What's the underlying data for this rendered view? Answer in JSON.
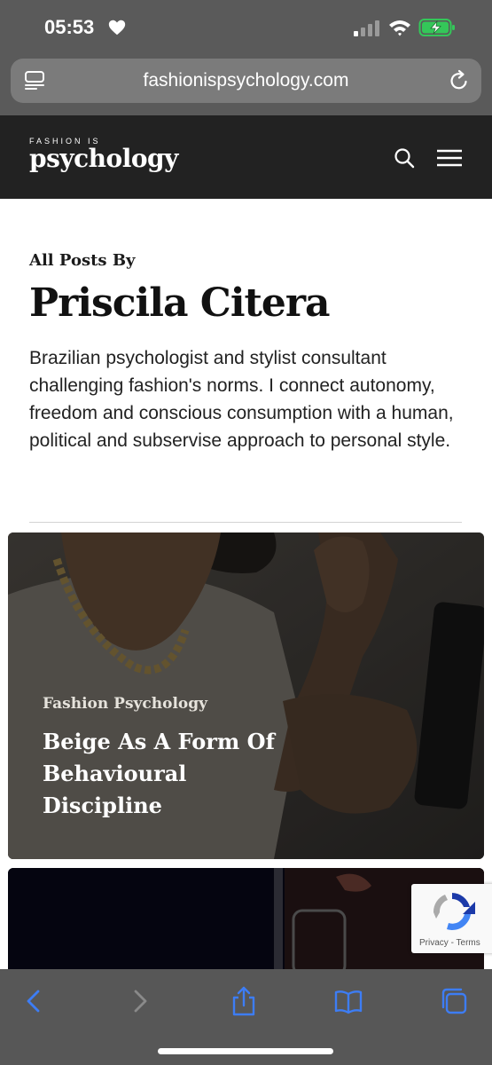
{
  "status_bar": {
    "time": "05:53"
  },
  "browser": {
    "url": "fashionispsychology.com"
  },
  "site": {
    "logo_small": "FASHION IS",
    "logo_big": "psychology"
  },
  "author": {
    "posts_by_label": "All Posts By",
    "name": "Priscila Citera",
    "bio": "Brazilian psychologist and stylist consultant challenging fashion's norms. I connect autonomy, freedom and conscious consumption with a human, political and subservise approach to personal style."
  },
  "posts": [
    {
      "category": "Fashion Psychology",
      "title": "Beige As A Form Of Behavioural Discipline"
    }
  ],
  "recaptcha": {
    "privacy": "Privacy",
    "separator": " - ",
    "terms": "Terms"
  },
  "icons": {
    "heart": "heart-icon",
    "signal": "signal-icon",
    "wifi": "wifi-icon",
    "battery": "battery-charging-icon",
    "reader": "reader-mode-icon",
    "reload": "reload-icon",
    "search": "search-icon",
    "menu": "hamburger-menu-icon",
    "back": "chevron-left-icon",
    "forward": "chevron-right-icon",
    "share": "share-icon",
    "bookmarks": "book-icon",
    "tabs": "tabs-icon"
  },
  "colors": {
    "status_bar_bg": "#5a5a5a",
    "header_bg": "#222222",
    "toolbar_icon": "#3d7df5",
    "battery_green": "#34c759"
  }
}
